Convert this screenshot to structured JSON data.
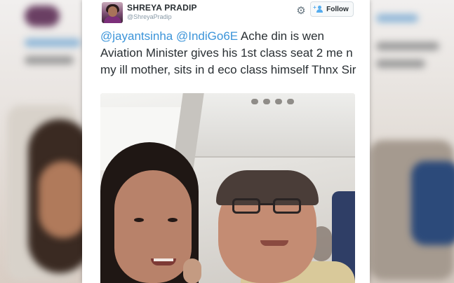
{
  "tweet": {
    "user": {
      "name": "SHREYA PRADIP",
      "handle": "@ShreyaPradip"
    },
    "follow_label": "Follow",
    "icons": {
      "settings": "gear-icon",
      "follow": "add-person-icon"
    },
    "text_parts": {
      "mention1": "@jayantsinha",
      "space": " ",
      "mention2": "@IndiGo6E",
      "body": " Ache din is wen Aviation Minister gives his 1st class seat 2 me n my ill mother, sits in d eco class himself Thnx Sir"
    },
    "colors": {
      "mention": "#3b94d9",
      "text": "#292f33",
      "handle": "#8899a6"
    }
  }
}
